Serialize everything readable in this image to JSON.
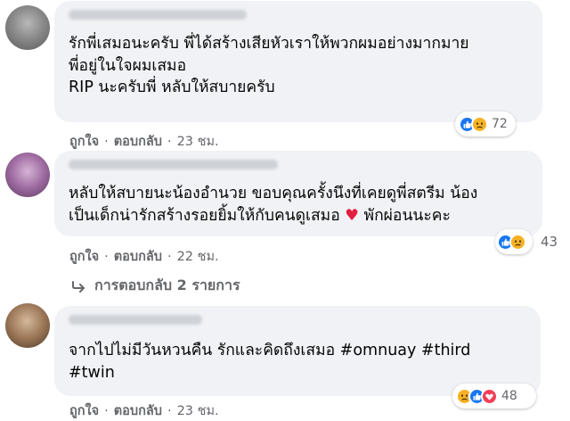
{
  "comments": [
    {
      "lines": [
        "รักพี่เสมอนะครับ พี่ได้สร้างเสียหัวเราให้พวกผมอย่างมากมาย",
        "พี่อยู่ในใจผมเสมอ",
        "RIP นะครับพี่ หลับให้สบายครับ"
      ],
      "reaction_count": "72",
      "reactions": [
        "like-icon",
        "sad-icon"
      ],
      "like_label": "ถูกใจ",
      "reply_label": "ตอบกลับ",
      "time": "23 ชม."
    },
    {
      "line1": "หลับให้สบายนะน้องอำนวย ขอบคุณครั้งนึงที่เคยดูพี่สตรีม น้อง",
      "line2_before": "เป็นเด็กน่ารักสร้างรอยยิ้มให้กับคนดูเสมอ ",
      "heart": "♥",
      "line2_after": " พักผ่อนนะคะ",
      "reaction_count": "43",
      "reactions": [
        "like-icon",
        "sad-icon"
      ],
      "like_label": "ถูกใจ",
      "reply_label": "ตอบกลับ",
      "time": "22 ชม.",
      "replies_label": "การตอบกลับ 2 รายการ"
    },
    {
      "lines": [
        "จากไปไม่มีวันหวนคืน รักและคิดถึงเสมอ #omnuay #third",
        "#twin"
      ],
      "reaction_count": "48",
      "reactions": [
        "sad-icon",
        "like-icon",
        "love-icon"
      ],
      "like_label": "ถูกใจ",
      "reply_label": "ตอบกลับ",
      "time": "23 ชม."
    }
  ],
  "separator": "·",
  "colors": {
    "bubble": "#f0f2f5",
    "like": "#1877f2",
    "sad": "#f7b125",
    "love": "#f33e58",
    "meta": "#65676b"
  }
}
